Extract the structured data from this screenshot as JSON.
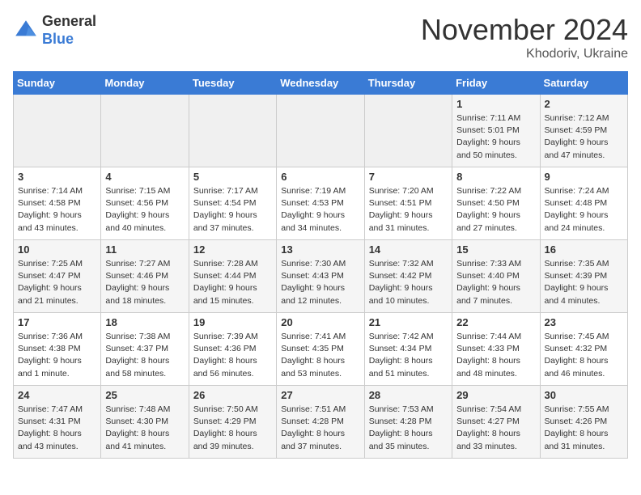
{
  "header": {
    "logo_general": "General",
    "logo_blue": "Blue",
    "month_title": "November 2024",
    "location": "Khodoriv, Ukraine"
  },
  "weekdays": [
    "Sunday",
    "Monday",
    "Tuesday",
    "Wednesday",
    "Thursday",
    "Friday",
    "Saturday"
  ],
  "weeks": [
    [
      {
        "day": "",
        "info": ""
      },
      {
        "day": "",
        "info": ""
      },
      {
        "day": "",
        "info": ""
      },
      {
        "day": "",
        "info": ""
      },
      {
        "day": "",
        "info": ""
      },
      {
        "day": "1",
        "info": "Sunrise: 7:11 AM\nSunset: 5:01 PM\nDaylight: 9 hours\nand 50 minutes."
      },
      {
        "day": "2",
        "info": "Sunrise: 7:12 AM\nSunset: 4:59 PM\nDaylight: 9 hours\nand 47 minutes."
      }
    ],
    [
      {
        "day": "3",
        "info": "Sunrise: 7:14 AM\nSunset: 4:58 PM\nDaylight: 9 hours\nand 43 minutes."
      },
      {
        "day": "4",
        "info": "Sunrise: 7:15 AM\nSunset: 4:56 PM\nDaylight: 9 hours\nand 40 minutes."
      },
      {
        "day": "5",
        "info": "Sunrise: 7:17 AM\nSunset: 4:54 PM\nDaylight: 9 hours\nand 37 minutes."
      },
      {
        "day": "6",
        "info": "Sunrise: 7:19 AM\nSunset: 4:53 PM\nDaylight: 9 hours\nand 34 minutes."
      },
      {
        "day": "7",
        "info": "Sunrise: 7:20 AM\nSunset: 4:51 PM\nDaylight: 9 hours\nand 31 minutes."
      },
      {
        "day": "8",
        "info": "Sunrise: 7:22 AM\nSunset: 4:50 PM\nDaylight: 9 hours\nand 27 minutes."
      },
      {
        "day": "9",
        "info": "Sunrise: 7:24 AM\nSunset: 4:48 PM\nDaylight: 9 hours\nand 24 minutes."
      }
    ],
    [
      {
        "day": "10",
        "info": "Sunrise: 7:25 AM\nSunset: 4:47 PM\nDaylight: 9 hours\nand 21 minutes."
      },
      {
        "day": "11",
        "info": "Sunrise: 7:27 AM\nSunset: 4:46 PM\nDaylight: 9 hours\nand 18 minutes."
      },
      {
        "day": "12",
        "info": "Sunrise: 7:28 AM\nSunset: 4:44 PM\nDaylight: 9 hours\nand 15 minutes."
      },
      {
        "day": "13",
        "info": "Sunrise: 7:30 AM\nSunset: 4:43 PM\nDaylight: 9 hours\nand 12 minutes."
      },
      {
        "day": "14",
        "info": "Sunrise: 7:32 AM\nSunset: 4:42 PM\nDaylight: 9 hours\nand 10 minutes."
      },
      {
        "day": "15",
        "info": "Sunrise: 7:33 AM\nSunset: 4:40 PM\nDaylight: 9 hours\nand 7 minutes."
      },
      {
        "day": "16",
        "info": "Sunrise: 7:35 AM\nSunset: 4:39 PM\nDaylight: 9 hours\nand 4 minutes."
      }
    ],
    [
      {
        "day": "17",
        "info": "Sunrise: 7:36 AM\nSunset: 4:38 PM\nDaylight: 9 hours\nand 1 minute."
      },
      {
        "day": "18",
        "info": "Sunrise: 7:38 AM\nSunset: 4:37 PM\nDaylight: 8 hours\nand 58 minutes."
      },
      {
        "day": "19",
        "info": "Sunrise: 7:39 AM\nSunset: 4:36 PM\nDaylight: 8 hours\nand 56 minutes."
      },
      {
        "day": "20",
        "info": "Sunrise: 7:41 AM\nSunset: 4:35 PM\nDaylight: 8 hours\nand 53 minutes."
      },
      {
        "day": "21",
        "info": "Sunrise: 7:42 AM\nSunset: 4:34 PM\nDaylight: 8 hours\nand 51 minutes."
      },
      {
        "day": "22",
        "info": "Sunrise: 7:44 AM\nSunset: 4:33 PM\nDaylight: 8 hours\nand 48 minutes."
      },
      {
        "day": "23",
        "info": "Sunrise: 7:45 AM\nSunset: 4:32 PM\nDaylight: 8 hours\nand 46 minutes."
      }
    ],
    [
      {
        "day": "24",
        "info": "Sunrise: 7:47 AM\nSunset: 4:31 PM\nDaylight: 8 hours\nand 43 minutes."
      },
      {
        "day": "25",
        "info": "Sunrise: 7:48 AM\nSunset: 4:30 PM\nDaylight: 8 hours\nand 41 minutes."
      },
      {
        "day": "26",
        "info": "Sunrise: 7:50 AM\nSunset: 4:29 PM\nDaylight: 8 hours\nand 39 minutes."
      },
      {
        "day": "27",
        "info": "Sunrise: 7:51 AM\nSunset: 4:28 PM\nDaylight: 8 hours\nand 37 minutes."
      },
      {
        "day": "28",
        "info": "Sunrise: 7:53 AM\nSunset: 4:28 PM\nDaylight: 8 hours\nand 35 minutes."
      },
      {
        "day": "29",
        "info": "Sunrise: 7:54 AM\nSunset: 4:27 PM\nDaylight: 8 hours\nand 33 minutes."
      },
      {
        "day": "30",
        "info": "Sunrise: 7:55 AM\nSunset: 4:26 PM\nDaylight: 8 hours\nand 31 minutes."
      }
    ]
  ]
}
